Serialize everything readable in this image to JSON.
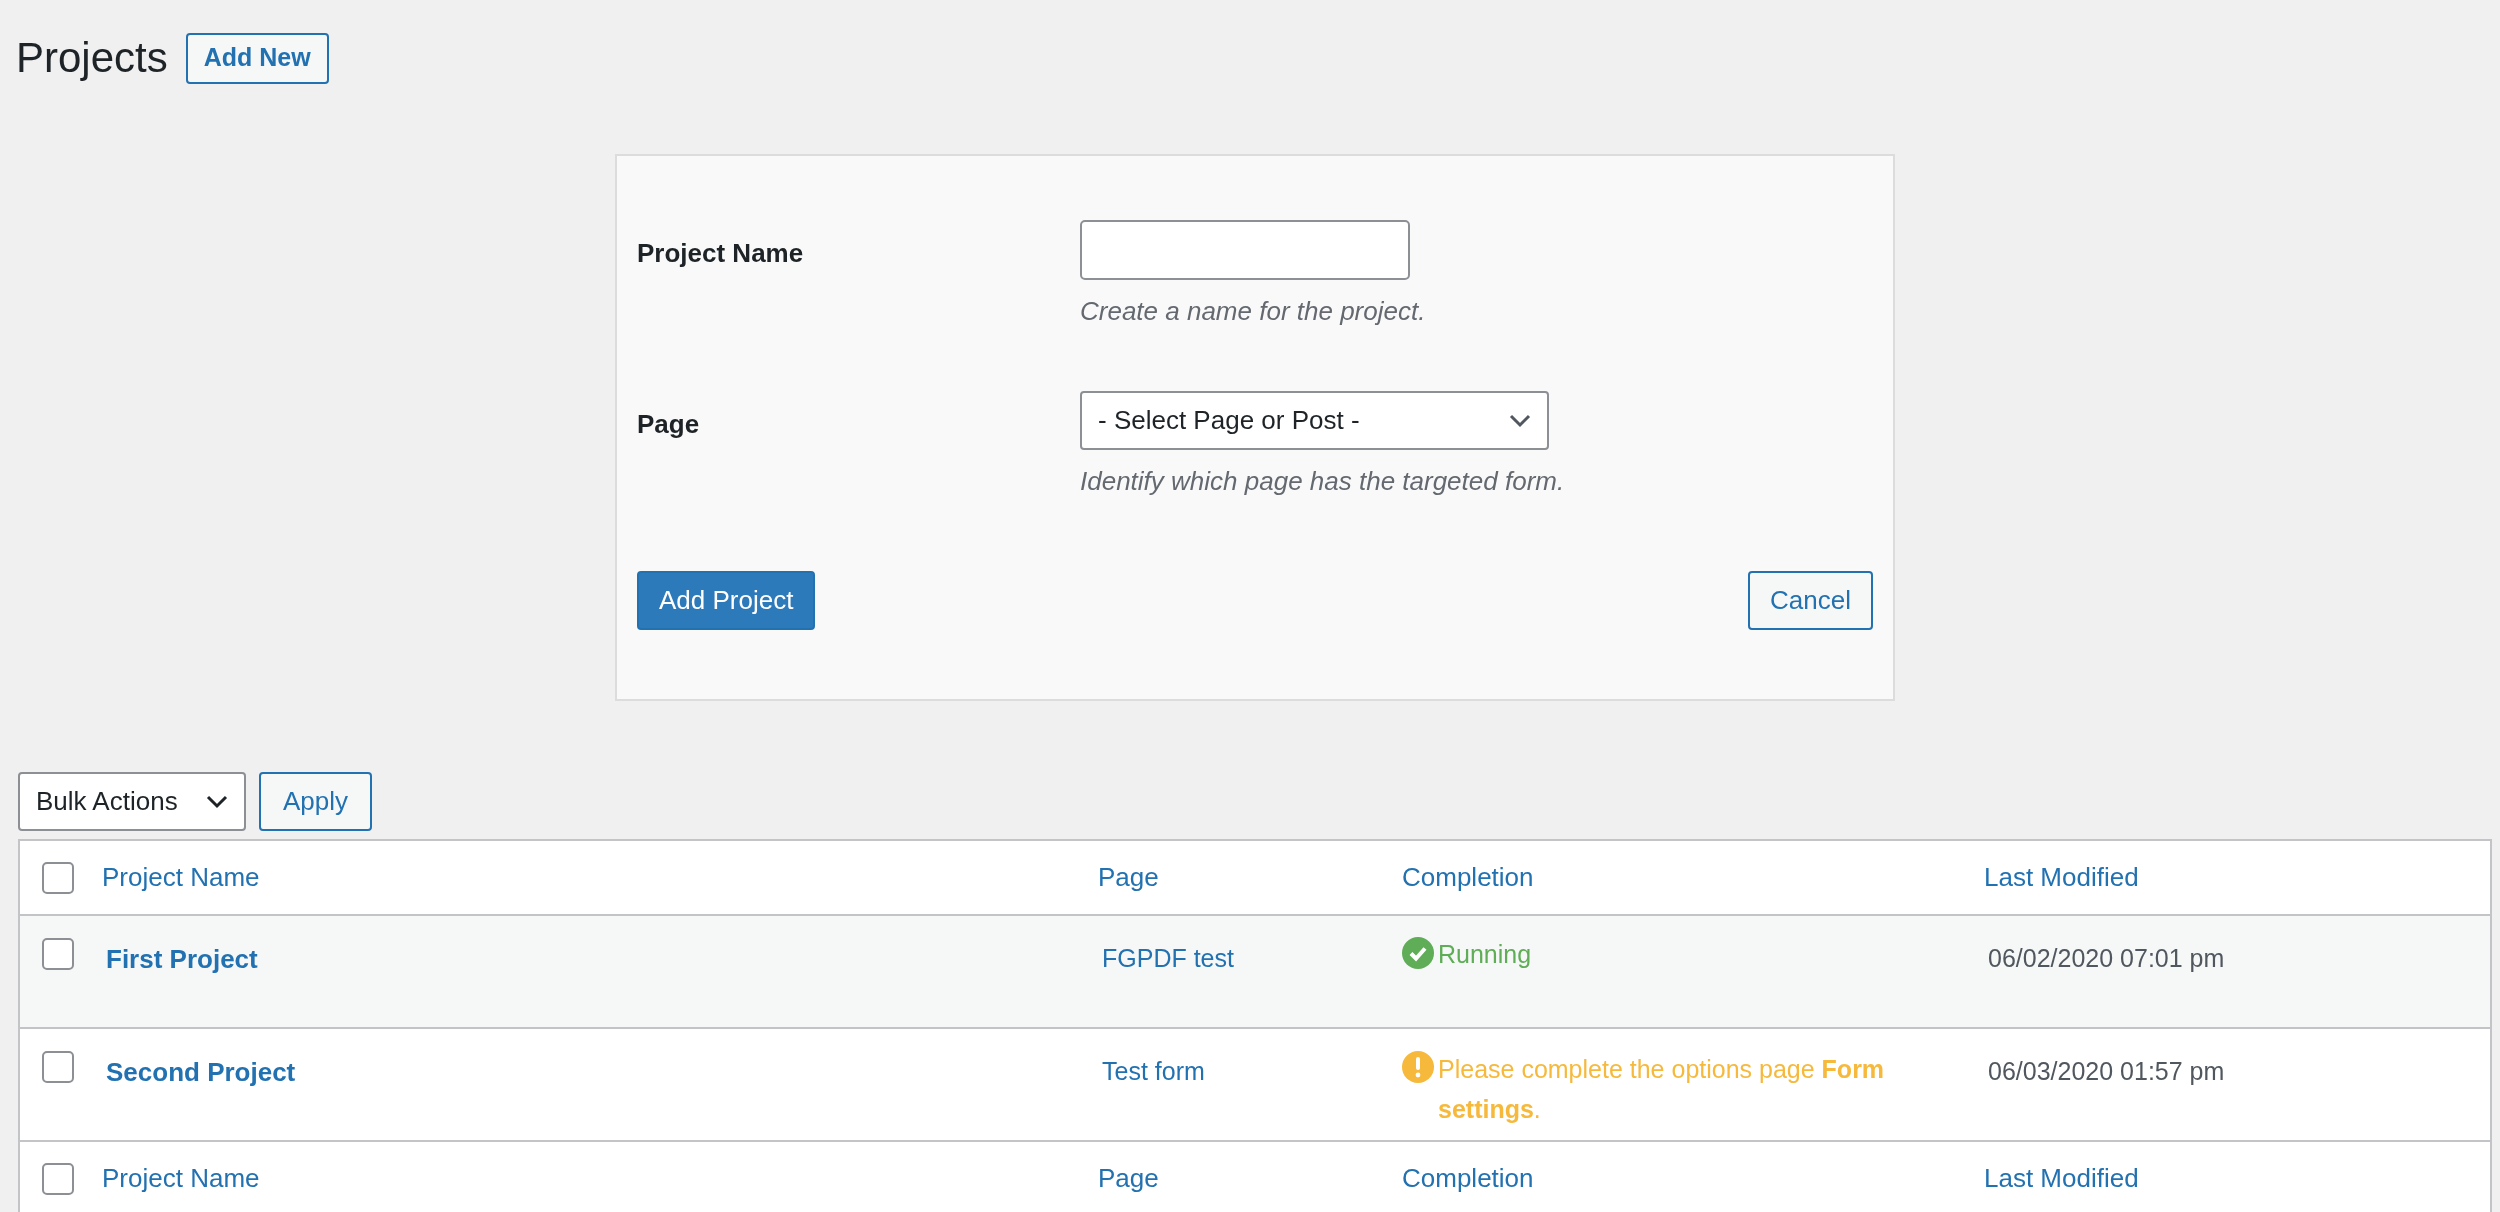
{
  "page": {
    "title": "Projects",
    "add_button": "Add New"
  },
  "form": {
    "fields": [
      {
        "kind": "text",
        "label": "Project Name",
        "help": "Create a name for the project."
      },
      {
        "kind": "select",
        "label": "Page",
        "value": "- Select Page or Post -",
        "help": "Identify which page has the targeted form."
      }
    ],
    "submit": "Add Project",
    "cancel": "Cancel"
  },
  "bulk": {
    "select": "Bulk Actions",
    "apply": "Apply"
  },
  "table": {
    "columns": [
      "Project Name",
      "Page",
      "Completion",
      "Last Modified"
    ],
    "footer_columns": [
      "Project Name",
      "Page",
      "Completion",
      "Last Modified"
    ],
    "header_checked": false,
    "footer_checked": false,
    "rows": [
      {
        "checked": false,
        "name": "First Project",
        "page": "FGPDF test",
        "status": {
          "kind": "running",
          "text": "Running"
        },
        "modified": "06/02/2020 07:01 pm"
      },
      {
        "checked": false,
        "name": "Second Project",
        "page": "Test form",
        "status": {
          "kind": "warning",
          "text": "Please complete the options page **Form settings**."
        },
        "modified": "06/03/2020 01:57 pm"
      }
    ]
  }
}
